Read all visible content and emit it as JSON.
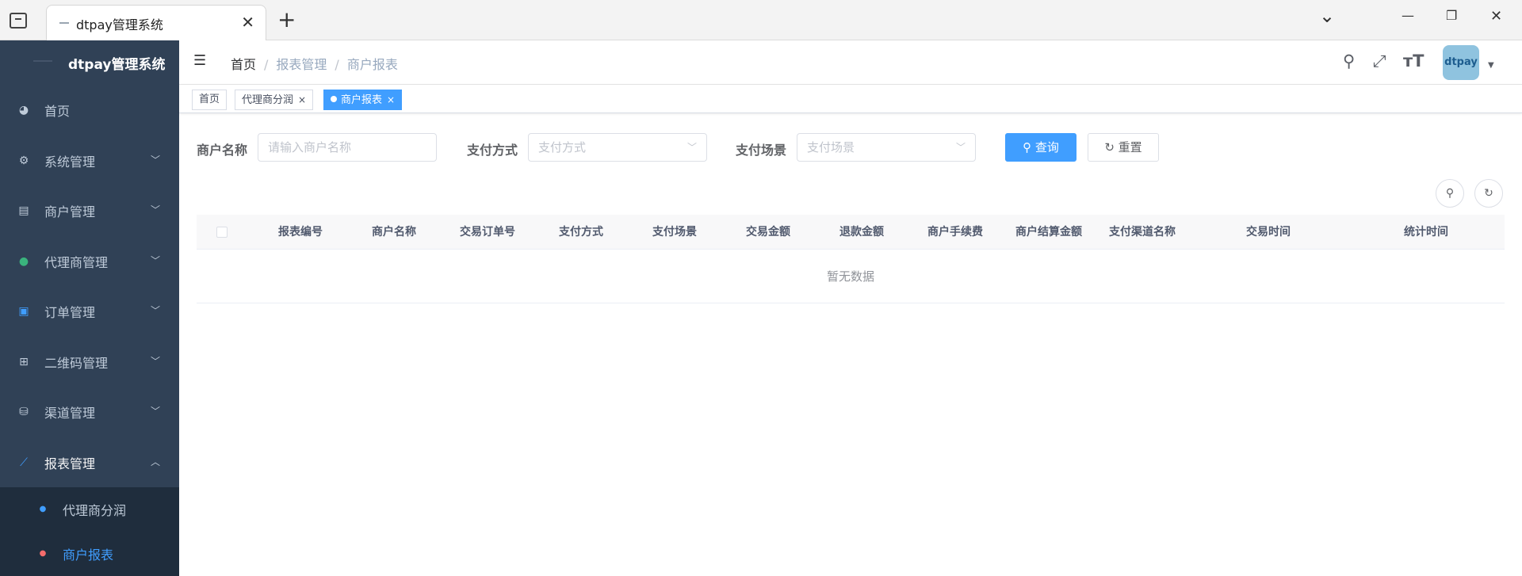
{
  "browser": {
    "tab_title": "dtpay管理系统",
    "close": "✕",
    "new_tab": "+",
    "dropdown": "⌄",
    "minimize": "—",
    "restore": "❐",
    "close_window": "✕"
  },
  "sidebar": {
    "app_name": "dtpay管理系统",
    "items": [
      {
        "label": "首页",
        "icon": "dashboard-icon"
      },
      {
        "label": "系统管理",
        "icon": "gear-icon"
      },
      {
        "label": "商户管理",
        "icon": "shop-icon"
      },
      {
        "label": "代理商管理",
        "icon": "users-icon"
      },
      {
        "label": "订单管理",
        "icon": "order-icon"
      },
      {
        "label": "二维码管理",
        "icon": "qrcode-icon"
      },
      {
        "label": "渠道管理",
        "icon": "channel-icon"
      },
      {
        "label": "报表管理",
        "icon": "chart-icon"
      }
    ],
    "sub_items": [
      {
        "label": "代理商分润",
        "icon": "doc-icon"
      },
      {
        "label": "商户报表",
        "icon": "report-icon"
      }
    ]
  },
  "navbar": {
    "breadcrumb": [
      "首页",
      "报表管理",
      "商户报表"
    ],
    "breadcrumb_sep": "/",
    "avatar_text": "dtpay"
  },
  "tags": [
    {
      "label": "首页"
    },
    {
      "label": "代理商分润",
      "close": "×"
    },
    {
      "label": "商户报表",
      "close": "×"
    }
  ],
  "search": {
    "merchant_name_label": "商户名称",
    "merchant_name_placeholder": "请输入商户名称",
    "pay_method_label": "支付方式",
    "pay_method_placeholder": "支付方式",
    "pay_scene_label": "支付场景",
    "pay_scene_placeholder": "支付场景",
    "query_label": "查询",
    "reset_label": "重置"
  },
  "table": {
    "columns": [
      "报表编号",
      "商户名称",
      "交易订单号",
      "支付方式",
      "支付场景",
      "交易金额",
      "退款金额",
      "商户手续费",
      "商户结算金额",
      "支付渠道名称",
      "交易时间",
      "统计时间"
    ],
    "empty_text": "暂无数据"
  },
  "colors": {
    "primary": "#409eff",
    "sidebar_bg": "#304156",
    "submenu_bg": "#1f2d3d"
  }
}
